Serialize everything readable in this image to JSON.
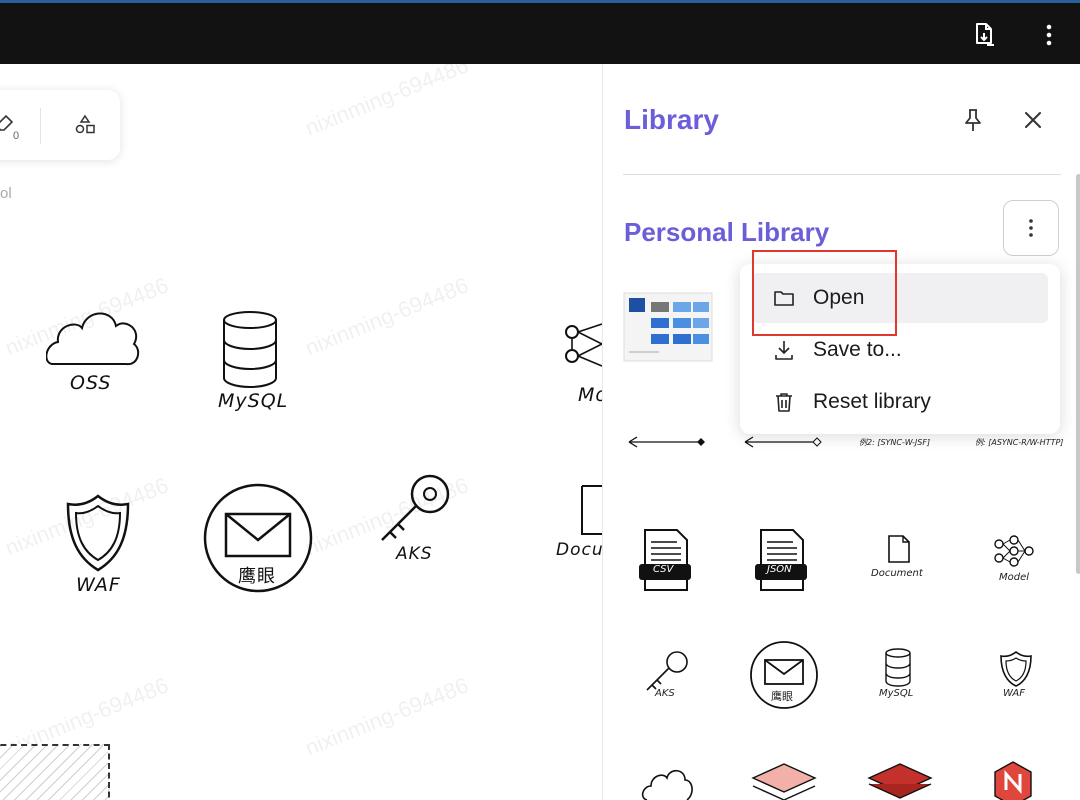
{
  "canvas": {
    "toolbar_sub_count": "0",
    "partial_text": "ol",
    "labels": {
      "oss": "OSS",
      "mysql": "MySQL",
      "mo": "Mo",
      "waf": "WAF",
      "eagle": "鹰眼",
      "aks": "AKS",
      "docu": "Docu"
    },
    "watermark": "nixinming-694486"
  },
  "library": {
    "title": "Library",
    "section_title": "Personal Library",
    "arrow_labels": [
      "例2: [SYNC-W-JSF]",
      "例: [ASYNC-R/W-HTTP]"
    ],
    "items": {
      "csv": "CSV",
      "json": "JSON",
      "document": "Document",
      "model": "Model",
      "aks": "AKS",
      "eagle": "鹰眼",
      "mysql": "MySQL",
      "waf": "WAF"
    }
  },
  "menu": {
    "items": [
      {
        "label": "Open",
        "icon": "folder-icon"
      },
      {
        "label": "Save to...",
        "icon": "download-icon"
      },
      {
        "label": "Reset library",
        "icon": "trash-icon"
      }
    ]
  },
  "colors": {
    "accent": "#6a5fd8",
    "highlight": "#e0382e",
    "topbar": "#121212"
  }
}
